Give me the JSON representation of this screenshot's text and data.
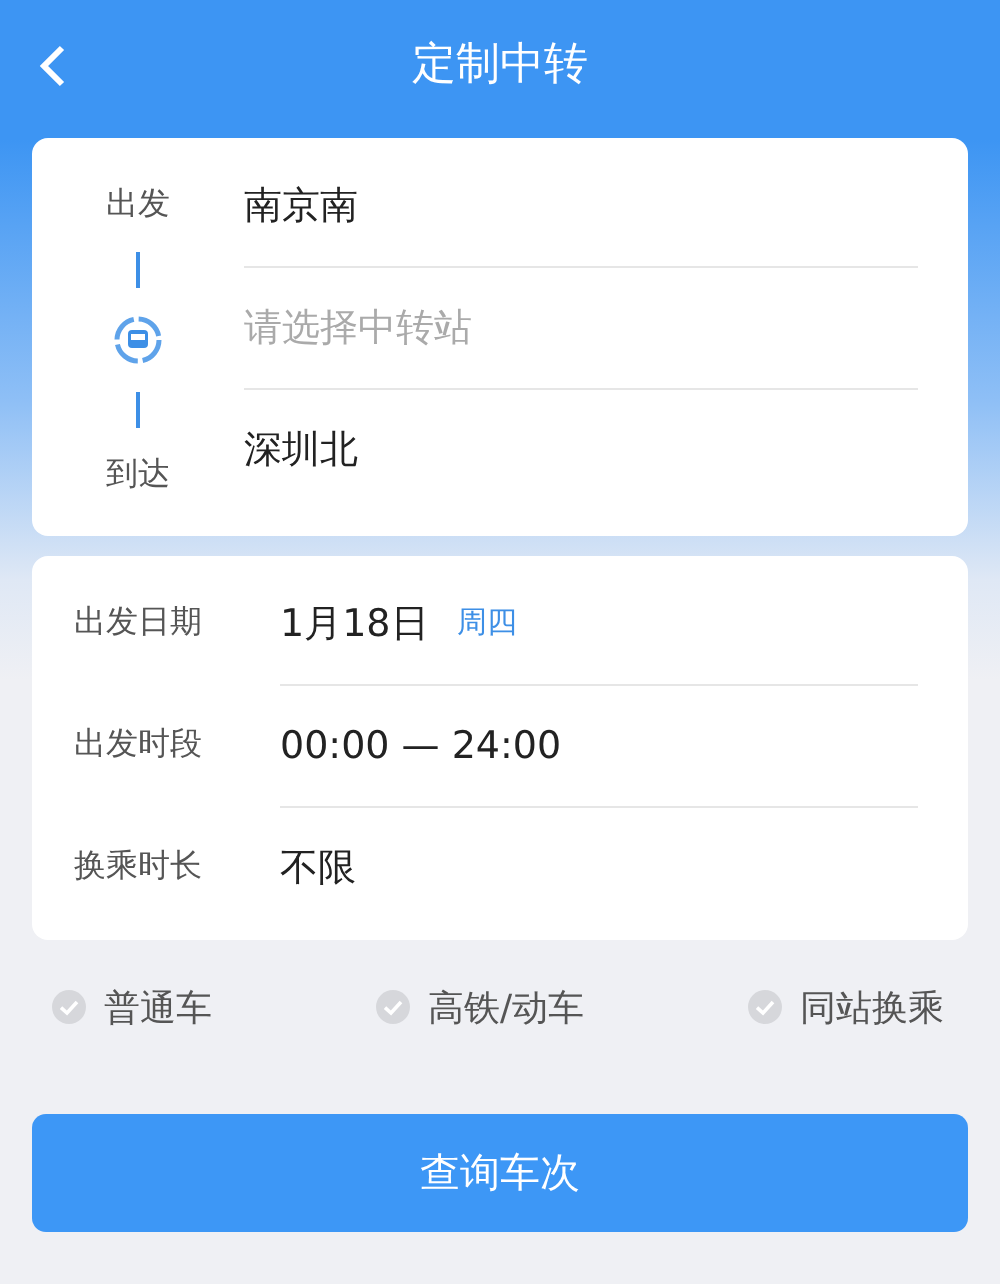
{
  "header": {
    "title": "定制中转"
  },
  "route": {
    "departure": {
      "label": "出发",
      "station": "南京南"
    },
    "transfer": {
      "placeholder": "请选择中转站"
    },
    "arrival": {
      "label": "到达",
      "station": "深圳北"
    }
  },
  "conditions": [
    {
      "label": "出发日期",
      "value": "1月18日",
      "weekday": "周四"
    },
    {
      "label": "出发时段",
      "value": "00:00 — 24:00"
    },
    {
      "label": "换乘时长",
      "value": "不限"
    }
  ],
  "filters": [
    {
      "label": "普通车",
      "checked": false
    },
    {
      "label": "高铁/动车",
      "checked": false
    },
    {
      "label": "同站换乘",
      "checked": false
    }
  ],
  "search_button": "查询车次"
}
